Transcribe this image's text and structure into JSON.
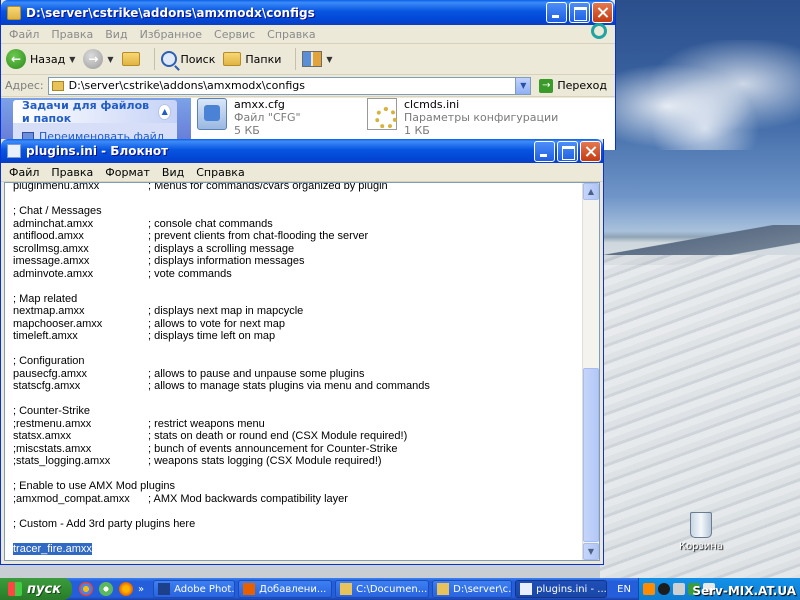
{
  "explorer": {
    "title": "D:\\server\\cstrike\\addons\\amxmodx\\configs",
    "menu": [
      "Файл",
      "Правка",
      "Вид",
      "Избранное",
      "Сервис",
      "Справка"
    ],
    "toolbar": {
      "back_label": "Назад",
      "search_label": "Поиск",
      "folders_label": "Папки"
    },
    "address": {
      "label": "Адрес:",
      "value": "D:\\server\\cstrike\\addons\\amxmodx\\configs",
      "go_label": "Переход"
    },
    "taskpane": {
      "header": "Задачи для файлов и папок",
      "item": "Переименовать файл"
    },
    "files": [
      {
        "name": "amxx.cfg",
        "type": "Файл \"CFG\"",
        "size": "5 КБ",
        "icon": "cfg-file-icon"
      },
      {
        "name": "clcmds.ini",
        "type": "Параметры конфигурации",
        "size": "1 КБ",
        "icon": "ini-settings-icon"
      }
    ]
  },
  "notepad": {
    "title": "plugins.ini - Блокнот",
    "menu": [
      "Файл",
      "Правка",
      "Формат",
      "Вид",
      "Справка"
    ],
    "lines": [
      {
        "a": "pluginmenu.amxx",
        "b": "; Menus for commands/cvars organized by plugin"
      },
      {
        "a": "",
        "b": ""
      },
      {
        "a": "; Chat / Messages",
        "b": ""
      },
      {
        "a": "adminchat.amxx",
        "b": "; console chat commands"
      },
      {
        "a": "antiflood.amxx",
        "b": "; prevent clients from chat-flooding the server"
      },
      {
        "a": "scrollmsg.amxx",
        "b": "; displays a scrolling message"
      },
      {
        "a": "imessage.amxx",
        "b": "; displays information messages"
      },
      {
        "a": "adminvote.amxx",
        "b": "; vote commands"
      },
      {
        "a": "",
        "b": ""
      },
      {
        "a": "; Map related",
        "b": ""
      },
      {
        "a": "nextmap.amxx",
        "b": "; displays next map in mapcycle"
      },
      {
        "a": "mapchooser.amxx",
        "b": "; allows to vote for next map"
      },
      {
        "a": "timeleft.amxx",
        "b": "; displays time left on map"
      },
      {
        "a": "",
        "b": ""
      },
      {
        "a": "; Configuration",
        "b": ""
      },
      {
        "a": "pausecfg.amxx",
        "b": "; allows to pause and unpause some plugins"
      },
      {
        "a": "statscfg.amxx",
        "b": "; allows to manage stats plugins via menu and commands"
      },
      {
        "a": "",
        "b": ""
      },
      {
        "a": "; Counter-Strike",
        "b": ""
      },
      {
        "a": ";restmenu.amxx",
        "b": "; restrict weapons menu"
      },
      {
        "a": "statsx.amxx",
        "b": "; stats on death or round end (CSX Module required!)"
      },
      {
        "a": ";miscstats.amxx",
        "b": "; bunch of events announcement for Counter-Strike"
      },
      {
        "a": ";stats_logging.amxx",
        "b": "; weapons stats logging (CSX Module required!)"
      },
      {
        "a": "",
        "b": ""
      },
      {
        "a": "; Enable to use AMX Mod plugins",
        "b": ""
      },
      {
        "a": ";amxmod_compat.amxx",
        "b": "; AMX Mod backwards compatibility layer"
      },
      {
        "a": "",
        "b": ""
      },
      {
        "a": "; Custom - Add 3rd party plugins here",
        "b": ""
      },
      {
        "a": "",
        "b": ""
      },
      {
        "a": "tracer_fire.amxx",
        "b": "",
        "selected": true
      }
    ]
  },
  "desktop": {
    "recycle_bin_label": "Корзина"
  },
  "taskbar": {
    "start_label": "пуск",
    "buttons": [
      {
        "label": "Adobe Phot...",
        "icon": "photoshop-icon",
        "color": "#1e3f8a"
      },
      {
        "label": "Добавлени...",
        "icon": "firefox-icon",
        "color": "#e66000"
      },
      {
        "label": "C:\\Documen...",
        "icon": "folder-icon",
        "color": "#e8c25a"
      },
      {
        "label": "D:\\server\\c...",
        "icon": "folder-icon",
        "color": "#e8c25a"
      },
      {
        "label": "plugins.ini - ...",
        "icon": "notepad-icon",
        "color": "#e9f0fb",
        "active": true
      }
    ],
    "language": "EN",
    "watermark": "Serv-MIX.AT.UA"
  }
}
